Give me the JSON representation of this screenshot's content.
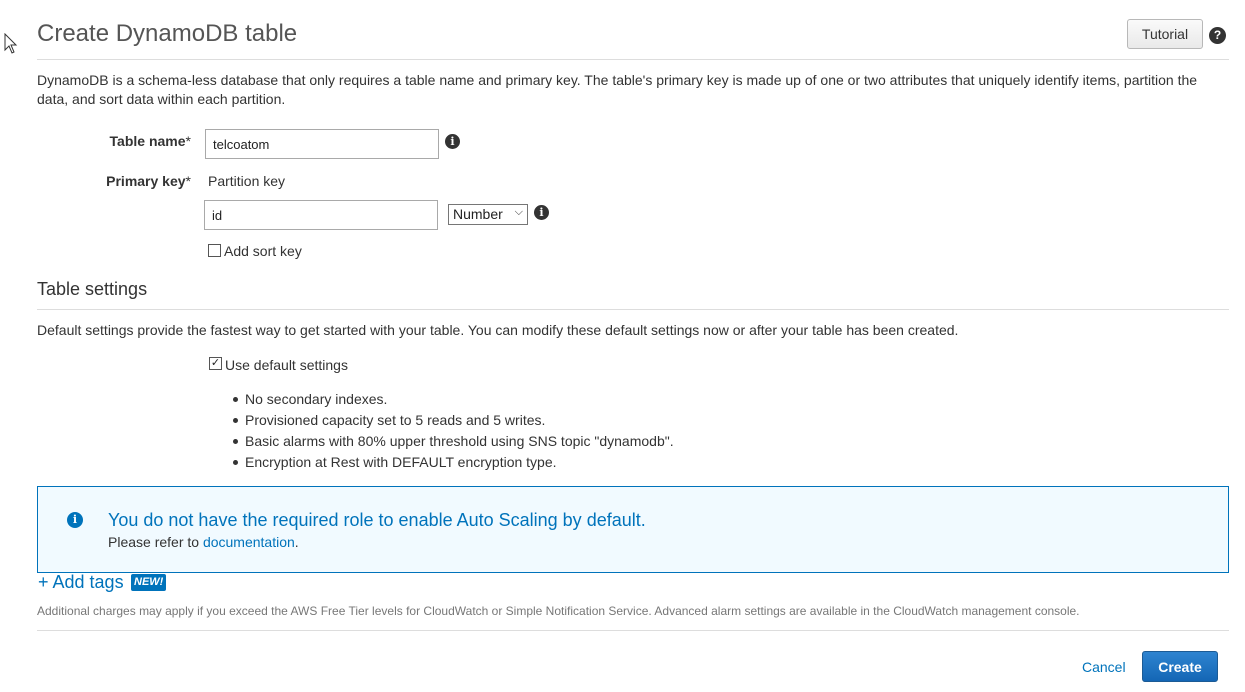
{
  "header": {
    "title": "Create DynamoDB table",
    "tutorial_label": "Tutorial",
    "help_glyph": "?"
  },
  "intro": "DynamoDB is a schema-less database that only requires a table name and primary key. The table's primary key is made up of one or two attributes that uniquely identify items, partition the data, and sort data within each partition.",
  "form": {
    "table_name_label": "Table name",
    "required_mark": "*",
    "table_name_value": "telcoatom",
    "primary_key_label": "Primary key",
    "partition_key_label": "Partition key",
    "partition_key_value": "id",
    "key_type_selected": "Number",
    "add_sort_key_label": "Add sort key",
    "add_sort_key_checked": false
  },
  "settings": {
    "title": "Table settings",
    "description": "Default settings provide the fastest way to get started with your table. You can modify these default settings now or after your table has been created.",
    "use_default_label": "Use default settings",
    "use_default_checked": true,
    "defaults": [
      "No secondary indexes.",
      "Provisioned capacity set to 5 reads and 5 writes.",
      "Basic alarms with 80% upper threshold using SNS topic \"dynamodb\".",
      "Encryption at Rest with DEFAULT encryption type."
    ]
  },
  "notice": {
    "title": "You do not have the required role to enable Auto Scaling by default.",
    "text_prefix": "Please refer to",
    "link": "documentation",
    "text_suffix": ".",
    "accent_color": "#0073bb"
  },
  "tags": {
    "add_label": "+ Add tags",
    "badge": "NEW!"
  },
  "footnote": "Additional charges may apply if you exceed the AWS Free Tier levels for CloudWatch or Simple Notification Service. Advanced alarm settings are available in the CloudWatch management console.",
  "actions": {
    "cancel_label": "Cancel",
    "create_label": "Create",
    "primary_color": "#1466b5"
  },
  "icons": {
    "info_glyph": "i",
    "check_glyph": "✓",
    "chevron_glyph": "⌵"
  }
}
